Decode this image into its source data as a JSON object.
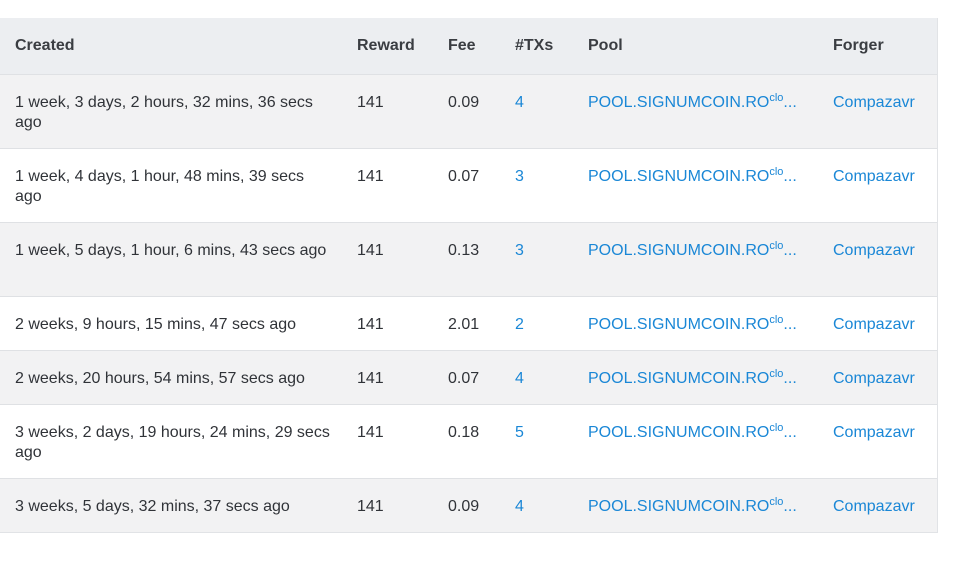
{
  "table": {
    "headers": {
      "created": "Created",
      "reward": "Reward",
      "fee": "Fee",
      "txs": "#TXs",
      "pool": "Pool",
      "forger": "Forger"
    },
    "rows": [
      {
        "created": "1 week, 3 days, 2 hours, 32 mins, 36 secs ago",
        "reward": "141",
        "fee": "0.09",
        "txs": "4",
        "pool": "POOL.SIGNUMCOIN.RO",
        "pool_sup": "clo",
        "pool_ellipsis": "...",
        "forger": "Compazavr"
      },
      {
        "created": "1 week, 4 days, 1 hour, 48 mins, 39 secs ago",
        "reward": "141",
        "fee": "0.07",
        "txs": "3",
        "pool": "POOL.SIGNUMCOIN.RO",
        "pool_sup": "clo",
        "pool_ellipsis": "...",
        "forger": "Compazavr"
      },
      {
        "created": "1 week, 5 days, 1 hour, 6 mins, 43 secs ago",
        "reward": "141",
        "fee": "0.13",
        "txs": "3",
        "pool": "POOL.SIGNUMCOIN.RO",
        "pool_sup": "clo",
        "pool_ellipsis": "...",
        "forger": "Compazavr"
      },
      {
        "created": "2 weeks, 9 hours, 15 mins, 47 secs ago",
        "reward": "141",
        "fee": "2.01",
        "txs": "2",
        "pool": "POOL.SIGNUMCOIN.RO",
        "pool_sup": "clo",
        "pool_ellipsis": "...",
        "forger": "Compazavr"
      },
      {
        "created": "2 weeks, 20 hours, 54 mins, 57 secs ago",
        "reward": "141",
        "fee": "0.07",
        "txs": "4",
        "pool": "POOL.SIGNUMCOIN.RO",
        "pool_sup": "clo",
        "pool_ellipsis": "...",
        "forger": "Compazavr"
      },
      {
        "created": "3 weeks, 2 days, 19 hours, 24 mins, 29 secs ago",
        "reward": "141",
        "fee": "0.18",
        "txs": "5",
        "pool": "POOL.SIGNUMCOIN.RO",
        "pool_sup": "clo",
        "pool_ellipsis": "...",
        "forger": "Compazavr"
      },
      {
        "created": "3 weeks, 5 days, 32 mins, 37 secs ago",
        "reward": "141",
        "fee": "0.09",
        "txs": "4",
        "pool": "POOL.SIGNUMCOIN.RO",
        "pool_sup": "clo",
        "pool_ellipsis": "...",
        "forger": "Compazavr"
      }
    ]
  },
  "colors": {
    "link": "#1a87d6",
    "header_bg": "#eceef1",
    "row_alt_bg": "#f2f2f3"
  }
}
